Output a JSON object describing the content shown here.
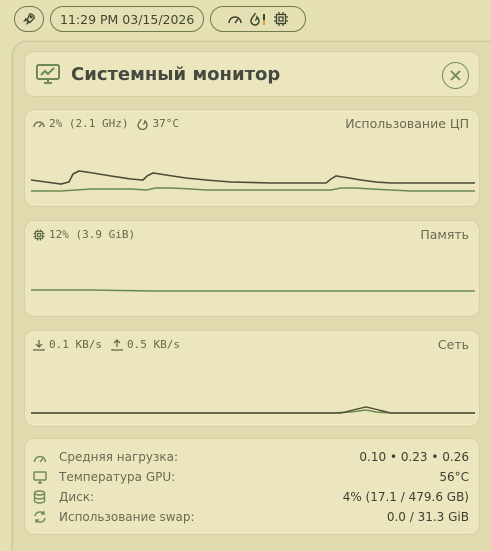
{
  "topbar": {
    "clock": "11:29 PM 03/15/2026"
  },
  "window": {
    "title": "Системный монитор"
  },
  "cpu": {
    "usage": "2% (2.1 GHz)",
    "temp": "37°C",
    "label": "Использование ЦП"
  },
  "memory": {
    "usage": "12% (3.9 GiB)",
    "label": "Память"
  },
  "network": {
    "down": "0.1 KB/s",
    "up": "0.5 KB/s",
    "label": "Сеть"
  },
  "stats": {
    "load_label": "Средняя нагрузка:",
    "load_value": "0.10 • 0.23 • 0.26",
    "gpu_label": "Температура GPU:",
    "gpu_value": "56°C",
    "disk_label": "Диск:",
    "disk_value": "4% (17.1 / 479.6 GB)",
    "swap_label": "Использование swap:",
    "swap_value": "0.0 / 31.3 GiB"
  },
  "colors": {
    "accent": "#6f8a55",
    "graph_dark": "#4e4a38",
    "graph_green": "#6d8a4e"
  }
}
